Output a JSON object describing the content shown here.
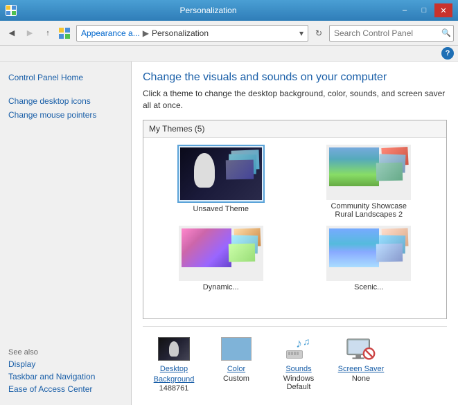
{
  "window": {
    "title": "Personalization",
    "icon": "folder-icon"
  },
  "titlebar": {
    "minimize_label": "–",
    "restore_label": "□",
    "close_label": "✕"
  },
  "addressbar": {
    "back_tooltip": "Back",
    "forward_tooltip": "Forward",
    "up_tooltip": "Up",
    "breadcrumb_parent": "Appearance a...",
    "breadcrumb_sep": "▶",
    "breadcrumb_current": "Personalization",
    "refresh_tooltip": "Refresh",
    "search_placeholder": "Search Control Panel"
  },
  "help_button": "?",
  "sidebar": {
    "top_link": "Control Panel Home",
    "links": [
      "Change desktop icons",
      "Change mouse pointers"
    ],
    "see_also_label": "See also",
    "see_also_links": [
      "Display",
      "Taskbar and Navigation",
      "Ease of Access Center"
    ]
  },
  "content": {
    "title": "Change the visuals and sounds on your computer",
    "description": "Click a theme to change the desktop background, color, sounds, and screen saver all at once.",
    "themes_header": "My Themes (5)",
    "themes": [
      {
        "id": "unsaved",
        "label": "Unsaved Theme",
        "selected": true,
        "type": "astro"
      },
      {
        "id": "community",
        "label": "Community Showcase\nRural Landscapes 2",
        "selected": false,
        "type": "community"
      },
      {
        "id": "dynamic",
        "label": "Dynamic...",
        "selected": false,
        "type": "dynamic"
      },
      {
        "id": "scenic",
        "label": "Scenic...",
        "selected": false,
        "type": "scenic"
      }
    ],
    "bottom_items": [
      {
        "id": "desktop-background",
        "label": "Desktop\nBackground",
        "sublabel": "1488761",
        "icon": "desktop-bg-icon"
      },
      {
        "id": "color",
        "label": "Color",
        "sublabel": "Custom",
        "icon": "color-icon"
      },
      {
        "id": "sounds",
        "label": "Sounds",
        "sublabel": "Windows Default",
        "icon": "sounds-icon"
      },
      {
        "id": "screen-saver",
        "label": "Screen Saver",
        "sublabel": "None",
        "icon": "screensaver-icon"
      }
    ]
  }
}
